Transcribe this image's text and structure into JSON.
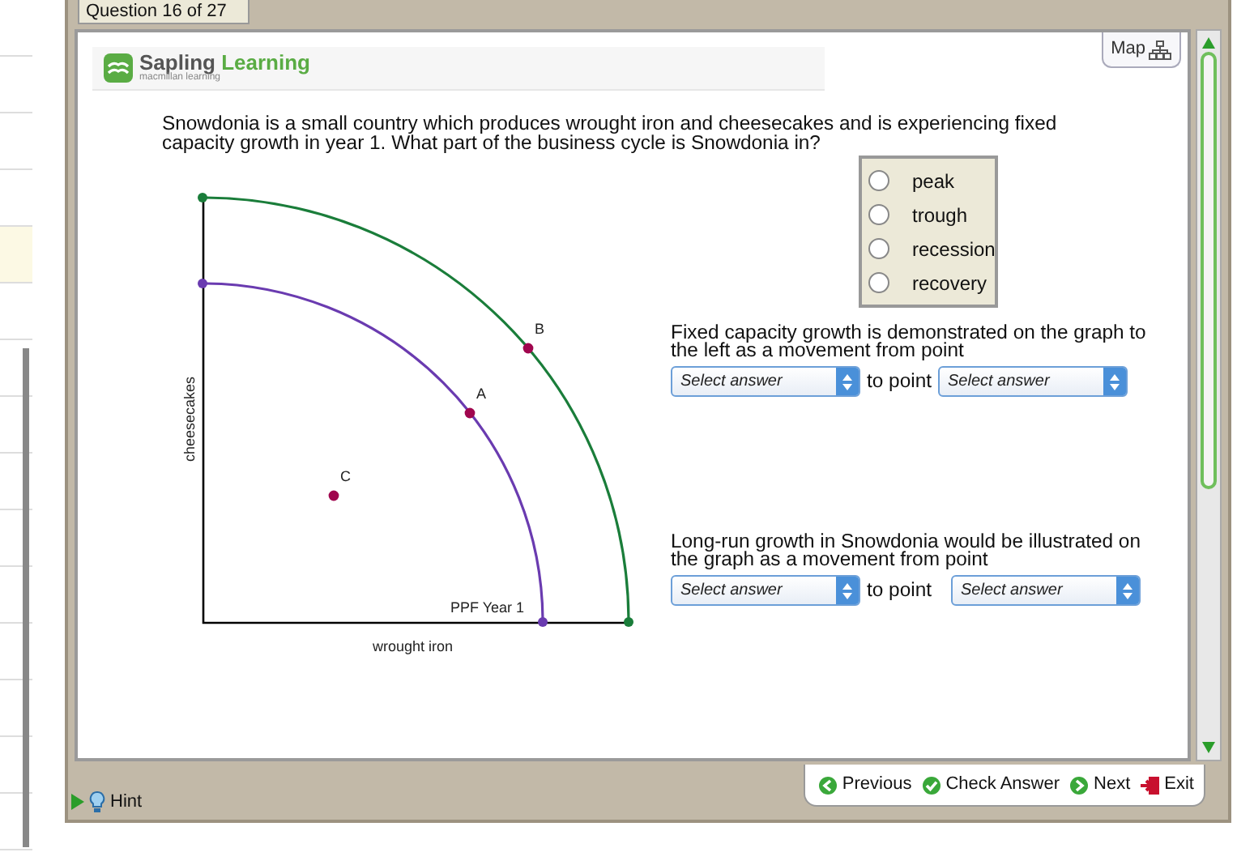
{
  "question_tab": "Question 16 of 27",
  "header": {
    "brand_first": "Sapling",
    "brand_second": "Learning",
    "tagline": "macmillan learning",
    "map_button": "Map"
  },
  "question": "Snowdonia is a small country which produces wrought iron and cheesecakes and is experiencing fixed capacity growth in year 1. What part of the business cycle is Snowdonia in?",
  "options": [
    {
      "label": "peak",
      "selected": false
    },
    {
      "label": "trough",
      "selected": false
    },
    {
      "label": "recession",
      "selected": false
    },
    {
      "label": "recovery",
      "selected": false
    }
  ],
  "graph": {
    "ylabel": "cheesecakes",
    "xlabel": "wrought iron",
    "curve_label": "PPF Year 1",
    "points": [
      {
        "label": "B"
      },
      {
        "label": "A"
      },
      {
        "label": "C"
      }
    ]
  },
  "blanks": [
    {
      "prompt": "Fixed capacity growth is demonstrated on the graph to the left as a movement from point",
      "first": "Select answer",
      "joiner": "to point",
      "second": "Select answer"
    },
    {
      "prompt": "Long-run growth in Snowdonia would be illustrated on the graph as a movement from point",
      "first": "Select answer",
      "joiner": "to point",
      "second": "Select answer"
    }
  ],
  "hint": "Hint",
  "nav": [
    {
      "kind": "previous",
      "label": "Previous"
    },
    {
      "kind": "check",
      "label": "Check Answer"
    },
    {
      "kind": "next",
      "label": "Next"
    },
    {
      "kind": "exit",
      "label": "Exit"
    }
  ]
}
